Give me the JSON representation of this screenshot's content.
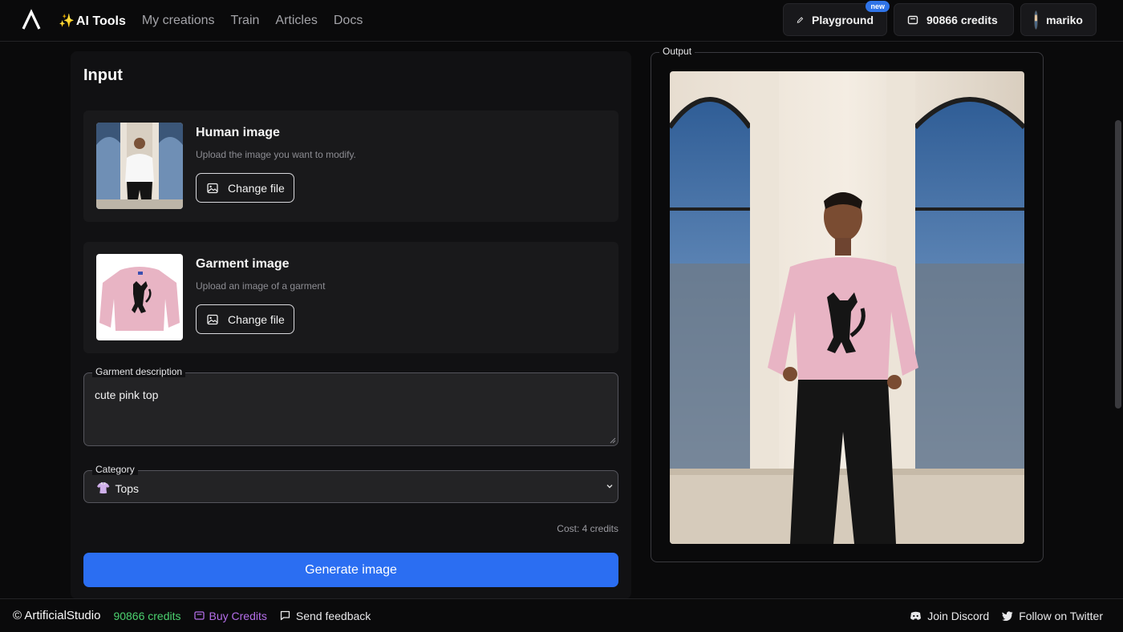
{
  "nav": {
    "links": [
      "AI Tools",
      "My creations",
      "Train",
      "Articles",
      "Docs"
    ],
    "spark": "✨",
    "playground_label": "Playground",
    "new_badge": "new",
    "credits_label": "90866 credits",
    "username": "mariko"
  },
  "input": {
    "title": "Input",
    "human": {
      "title": "Human image",
      "desc": "Upload the image you want to modify.",
      "button": "Change file"
    },
    "garment": {
      "title": "Garment image",
      "desc": "Upload an image of a garment",
      "button": "Change file"
    },
    "description": {
      "label": "Garment description",
      "value": "cute pink top"
    },
    "category": {
      "label": "Category",
      "emoji": "👚",
      "value": "Tops"
    },
    "cost": "Cost: 4 credits",
    "generate_label": "Generate image"
  },
  "output": {
    "label": "Output"
  },
  "footer": {
    "brand": "© ArtificialStudio",
    "credits": "90866 credits",
    "buy": "Buy Credits",
    "feedback": "Send feedback",
    "discord": "Join Discord",
    "twitter": "Follow on Twitter"
  },
  "colors": {
    "accent": "#2b6ef2",
    "credits_green": "#4bd16f",
    "buy_purple": "#b46ee8",
    "sweater_pink": "#e8b4c4"
  }
}
